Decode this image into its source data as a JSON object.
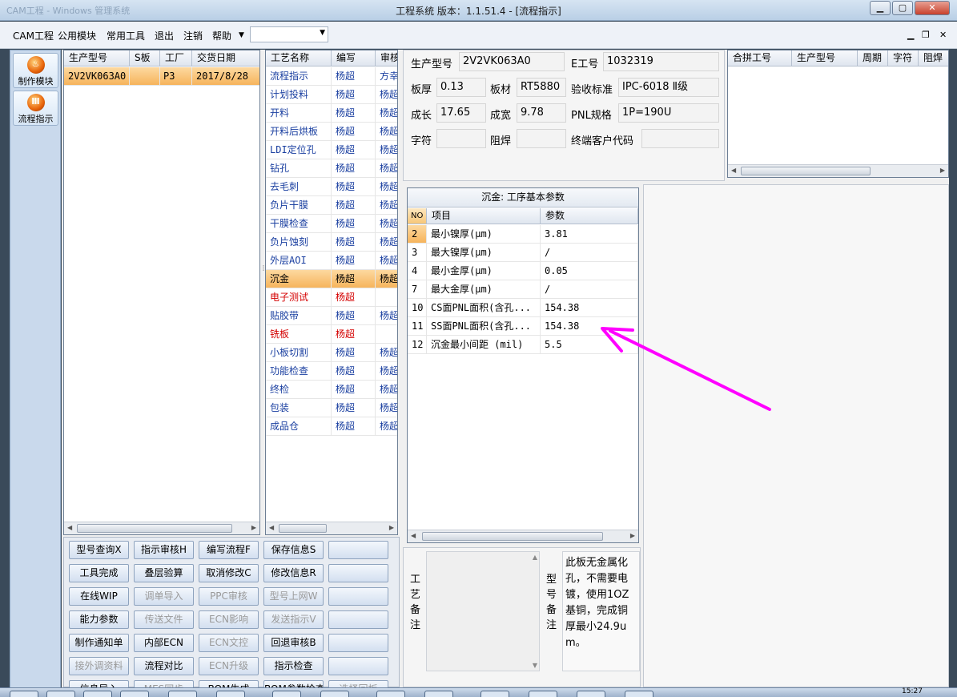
{
  "window": {
    "title": "工程系统   版本：1.1.51.4 - [流程指示]",
    "faded_caption": "CAM工程 - Windows 管理系统"
  },
  "menu": {
    "items": [
      "CAM工程",
      "公用模块",
      "常用工具",
      "退出",
      "注销",
      "帮助"
    ],
    "combo_value": ""
  },
  "dock": {
    "buttons": [
      {
        "label": "制作模块",
        "glyph": "♨"
      },
      {
        "label": "流程指示",
        "glyph": "Ⅲ"
      }
    ]
  },
  "orders": {
    "headers": [
      "生产型号",
      "S板",
      "工厂",
      "交货日期"
    ],
    "rows": [
      {
        "model": "2V2VK063A0",
        "s": "",
        "factory": "P3",
        "date": "2017/8/28"
      }
    ]
  },
  "process": {
    "headers": [
      "工艺名称",
      "编写",
      "审核"
    ],
    "rows": [
      {
        "name": "流程指示",
        "author": "杨超",
        "reviewer": "方幸"
      },
      {
        "name": "计划投料",
        "author": "杨超",
        "reviewer": "杨超"
      },
      {
        "name": "开料",
        "author": "杨超",
        "reviewer": "杨超"
      },
      {
        "name": "开料后烘板",
        "author": "杨超",
        "reviewer": "杨超"
      },
      {
        "name": "LDI定位孔",
        "author": "杨超",
        "reviewer": "杨超"
      },
      {
        "name": "钻孔",
        "author": "杨超",
        "reviewer": "杨超"
      },
      {
        "name": "去毛刺",
        "author": "杨超",
        "reviewer": "杨超"
      },
      {
        "name": "负片干膜",
        "author": "杨超",
        "reviewer": "杨超"
      },
      {
        "name": "干膜检查",
        "author": "杨超",
        "reviewer": "杨超"
      },
      {
        "name": "负片蚀刻",
        "author": "杨超",
        "reviewer": "杨超"
      },
      {
        "name": "外层AOI",
        "author": "杨超",
        "reviewer": "杨超"
      },
      {
        "name": "沉金",
        "author": "杨超",
        "reviewer": "杨超"
      },
      {
        "name": "电子测试",
        "author": "杨超",
        "reviewer": ""
      },
      {
        "name": "贴胶带",
        "author": "杨超",
        "reviewer": "杨超"
      },
      {
        "name": "铣板",
        "author": "杨超",
        "reviewer": ""
      },
      {
        "name": "小板切割",
        "author": "杨超",
        "reviewer": "杨超"
      },
      {
        "name": "功能检查",
        "author": "杨超",
        "reviewer": "杨超"
      },
      {
        "name": "终检",
        "author": "杨超",
        "reviewer": "杨超"
      },
      {
        "name": "包装",
        "author": "杨超",
        "reviewer": "杨超"
      },
      {
        "name": "成品仓",
        "author": "杨超",
        "reviewer": "杨超"
      }
    ],
    "selected_index": 11,
    "red_indices": [
      12,
      14
    ]
  },
  "actions": [
    [
      "型号查询X",
      "指示审核H",
      "编写流程F",
      "保存信息S",
      ""
    ],
    [
      "工具完成",
      "叠层验算",
      "取消修改C",
      "修改信息R",
      ""
    ],
    [
      "在线WIP",
      "调单导入",
      "PPC审核",
      "型号上网W",
      ""
    ],
    [
      "能力参数",
      "传送文件",
      "ECN影响",
      "发送指示V",
      ""
    ],
    [
      "制作通知单",
      "内部ECN",
      "ECN文控",
      "回退审核B",
      ""
    ],
    [
      "接外调资料",
      "流程对比",
      "ECN升级",
      "指示检查",
      ""
    ],
    [
      "信息导入",
      "MES同步",
      "BOM生成",
      "BOM参数检查",
      "选择回板"
    ]
  ],
  "actions_disabled": [
    [
      false,
      false,
      false,
      false,
      false
    ],
    [
      false,
      false,
      false,
      false,
      false
    ],
    [
      false,
      true,
      true,
      true,
      false
    ],
    [
      false,
      true,
      true,
      true,
      false
    ],
    [
      false,
      false,
      true,
      false,
      false
    ],
    [
      true,
      false,
      true,
      false,
      false
    ],
    [
      false,
      true,
      false,
      false,
      true
    ]
  ],
  "info": {
    "model_label": "生产型号",
    "model_value": "2V2VK063A0",
    "eno_label": "E工号",
    "eno_value": "1032319",
    "thickness_label": "板厚",
    "thickness_value": "0.13",
    "material_label": "板材",
    "material_value": "RT5880",
    "standard_label": "验收标准",
    "standard_value": "IPC-6018 Ⅱ级",
    "length_label": "成长",
    "length_value": "17.65",
    "width_label": "成宽",
    "width_value": "9.78",
    "pnl_label": "PNL规格",
    "pnl_value": "1P=190U",
    "char_label": "字符",
    "char_value": "",
    "mask_label": "阻焊",
    "mask_value": "",
    "customer_label": "终端客户代码",
    "customer_value": ""
  },
  "merge": {
    "headers": [
      "合拼工号",
      "生产型号",
      "周期",
      "字符",
      "阻焊"
    ]
  },
  "params": {
    "title": "沉金: 工序基本参数",
    "headers": [
      "NO",
      "项目",
      "参数"
    ],
    "rows": [
      {
        "no": "2",
        "item": "最小镍厚(μm)",
        "value": "3.81"
      },
      {
        "no": "3",
        "item": "最大镍厚(μm)",
        "value": "/"
      },
      {
        "no": "4",
        "item": "最小金厚(μm)",
        "value": "0.05"
      },
      {
        "no": "7",
        "item": "最大金厚(μm)",
        "value": "/"
      },
      {
        "no": "10",
        "item": "CS面PNL面积(含孔...",
        "value": "154.38"
      },
      {
        "no": "11",
        "item": "SS面PNL面积(含孔...",
        "value": "154.38"
      },
      {
        "no": "12",
        "item": "沉金最小间距 (mil)",
        "value": "5.5"
      }
    ]
  },
  "remarks": {
    "process_label": [
      "工",
      "艺",
      "备",
      "注"
    ],
    "model_label": [
      "型",
      "号",
      "备",
      "注"
    ],
    "model_text": "此板无金属化孔，不需要电镀，使用1OZ基铜，完成铜厚最小24.9um。"
  },
  "taskbar": {
    "clock": "15:27"
  },
  "colors": {
    "selection": "#f6b45c",
    "annotation_arrow": "#ff00ff",
    "red_text": "#d40000"
  }
}
